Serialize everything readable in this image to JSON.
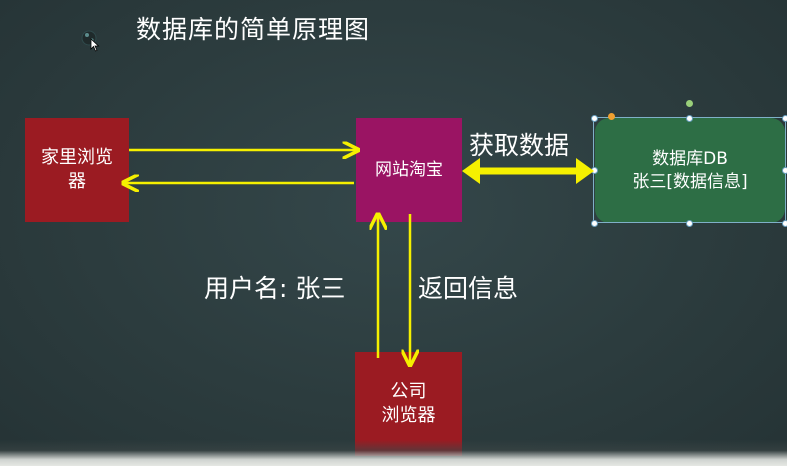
{
  "title": "数据库的简单原理图",
  "nodes": {
    "home_browser": {
      "line1": "家里浏览",
      "line2": "器"
    },
    "website": {
      "label": "网站淘宝"
    },
    "database": {
      "line1": "数据库DB",
      "line2": "张三[数据信息]"
    },
    "company_browser": {
      "line1": "公司",
      "line2": "浏览器"
    }
  },
  "edge_labels": {
    "fetch": "获取数据",
    "username": "用户名: 张三",
    "return_info": "返回信息"
  },
  "colors": {
    "arrow": "#f5f000",
    "home_browser": "#9b1b22",
    "website": "#9a1463",
    "database": "#2d6e45",
    "company_browser": "#9b1b22",
    "background": "#2c3c3e"
  },
  "icons": {
    "logo": "chalk-logo-icon",
    "cursor": "mouse-cursor-icon"
  }
}
